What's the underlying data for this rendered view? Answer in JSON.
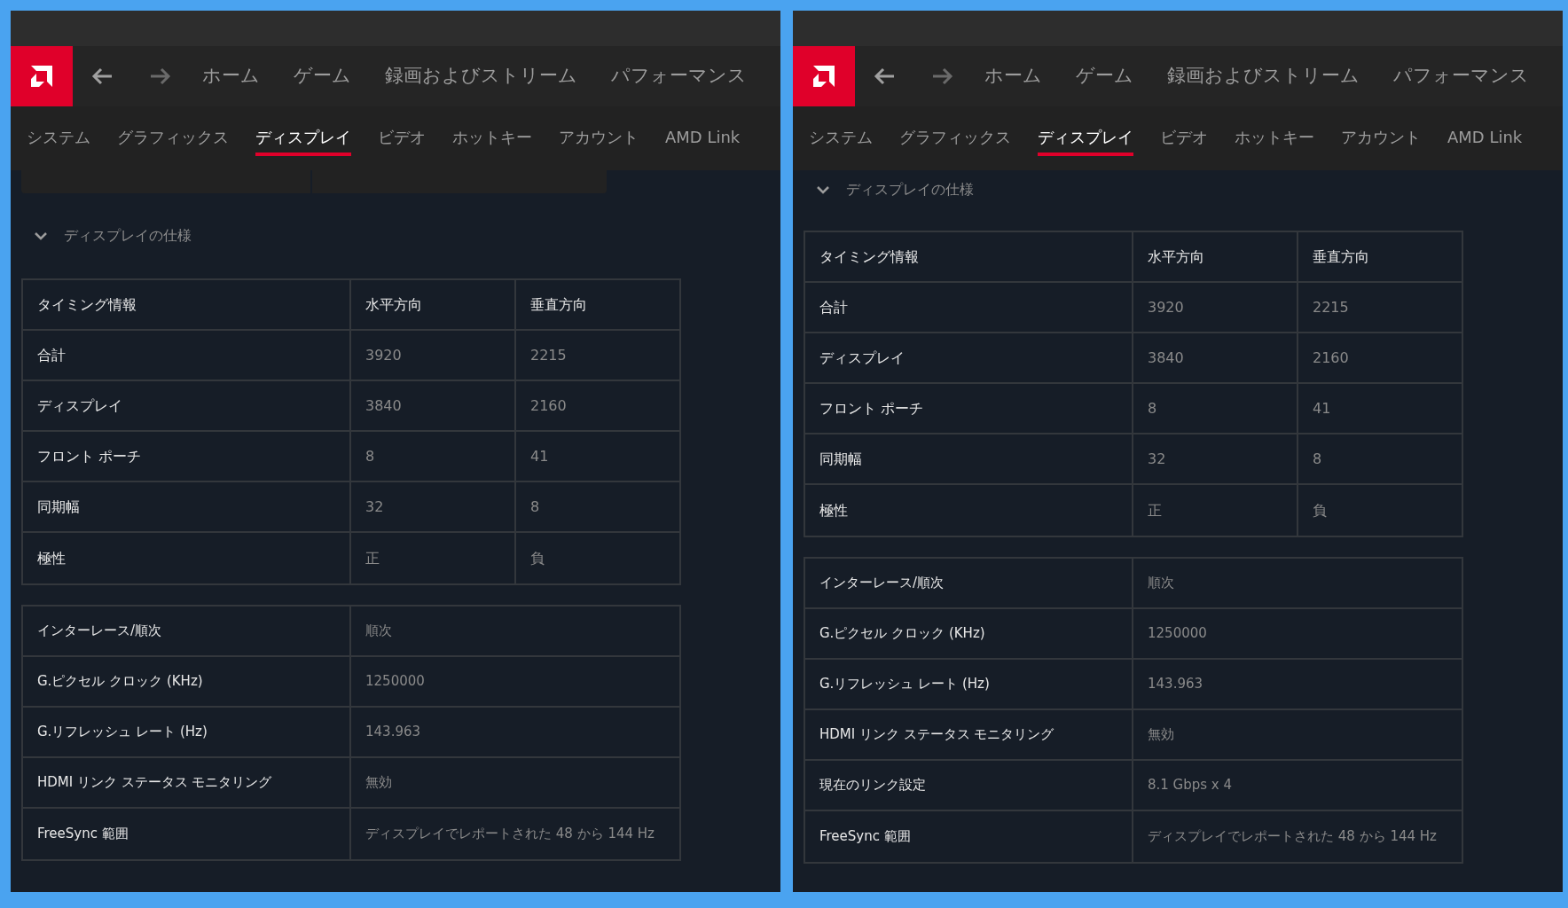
{
  "panels": [
    {
      "nav": {
        "items": [
          "ホーム",
          "ゲーム",
          "録画およびストリーム",
          "パフォーマンス"
        ]
      },
      "tabs": [
        {
          "label": "システム",
          "selected": false
        },
        {
          "label": "グラフィックス",
          "selected": false
        },
        {
          "label": "ディスプレイ",
          "selected": true
        },
        {
          "label": "ビデオ",
          "selected": false
        },
        {
          "label": "ホットキー",
          "selected": false
        },
        {
          "label": "アカウント",
          "selected": false
        },
        {
          "label": "AMD Link",
          "selected": false
        }
      ],
      "cut_card": true,
      "section": {
        "title": "ディスプレイの仕様",
        "expanded": true
      },
      "timing_table": {
        "columns": [
          "タイミング情報",
          "水平方向",
          "垂直方向"
        ],
        "rows": [
          [
            "合計",
            "3920",
            "2215"
          ],
          [
            "ディスプレイ",
            "3840",
            "2160"
          ],
          [
            "フロント ポーチ",
            "8",
            "41"
          ],
          [
            "同期幅",
            "32",
            "8"
          ],
          [
            "極性",
            "正",
            "負"
          ]
        ]
      },
      "info_table": {
        "rows": [
          [
            "インターレース/順次",
            "順次"
          ],
          [
            "G.ピクセル クロック (KHz)",
            "1250000"
          ],
          [
            "G.リフレッシュ レート (Hz)",
            "143.963"
          ],
          [
            "HDMI リンク ステータス モニタリング",
            "無効"
          ],
          [
            "FreeSync 範囲",
            "ディスプレイでレポートされた 48 から 144 Hz"
          ]
        ]
      }
    },
    {
      "nav": {
        "items": [
          "ホーム",
          "ゲーム",
          "録画およびストリーム",
          "パフォーマンス"
        ]
      },
      "tabs": [
        {
          "label": "システム",
          "selected": false
        },
        {
          "label": "グラフィックス",
          "selected": false
        },
        {
          "label": "ディスプレイ",
          "selected": true
        },
        {
          "label": "ビデオ",
          "selected": false
        },
        {
          "label": "ホットキー",
          "selected": false
        },
        {
          "label": "アカウント",
          "selected": false
        },
        {
          "label": "AMD Link",
          "selected": false
        }
      ],
      "cut_card": false,
      "section": {
        "title": "ディスプレイの仕様",
        "expanded": true
      },
      "timing_table": {
        "columns": [
          "タイミング情報",
          "水平方向",
          "垂直方向"
        ],
        "rows": [
          [
            "合計",
            "3920",
            "2215"
          ],
          [
            "ディスプレイ",
            "3840",
            "2160"
          ],
          [
            "フロント ポーチ",
            "8",
            "41"
          ],
          [
            "同期幅",
            "32",
            "8"
          ],
          [
            "極性",
            "正",
            "負"
          ]
        ]
      },
      "info_table": {
        "rows": [
          [
            "インターレース/順次",
            "順次"
          ],
          [
            "G.ピクセル クロック (KHz)",
            "1250000"
          ],
          [
            "G.リフレッシュ レート (Hz)",
            "143.963"
          ],
          [
            "HDMI リンク ステータス モニタリング",
            "無効"
          ],
          [
            "現在のリンク設定",
            "8.1 Gbps x 4"
          ],
          [
            "FreeSync 範囲",
            "ディスプレイでレポートされた 48 から 144 Hz"
          ]
        ]
      }
    }
  ]
}
